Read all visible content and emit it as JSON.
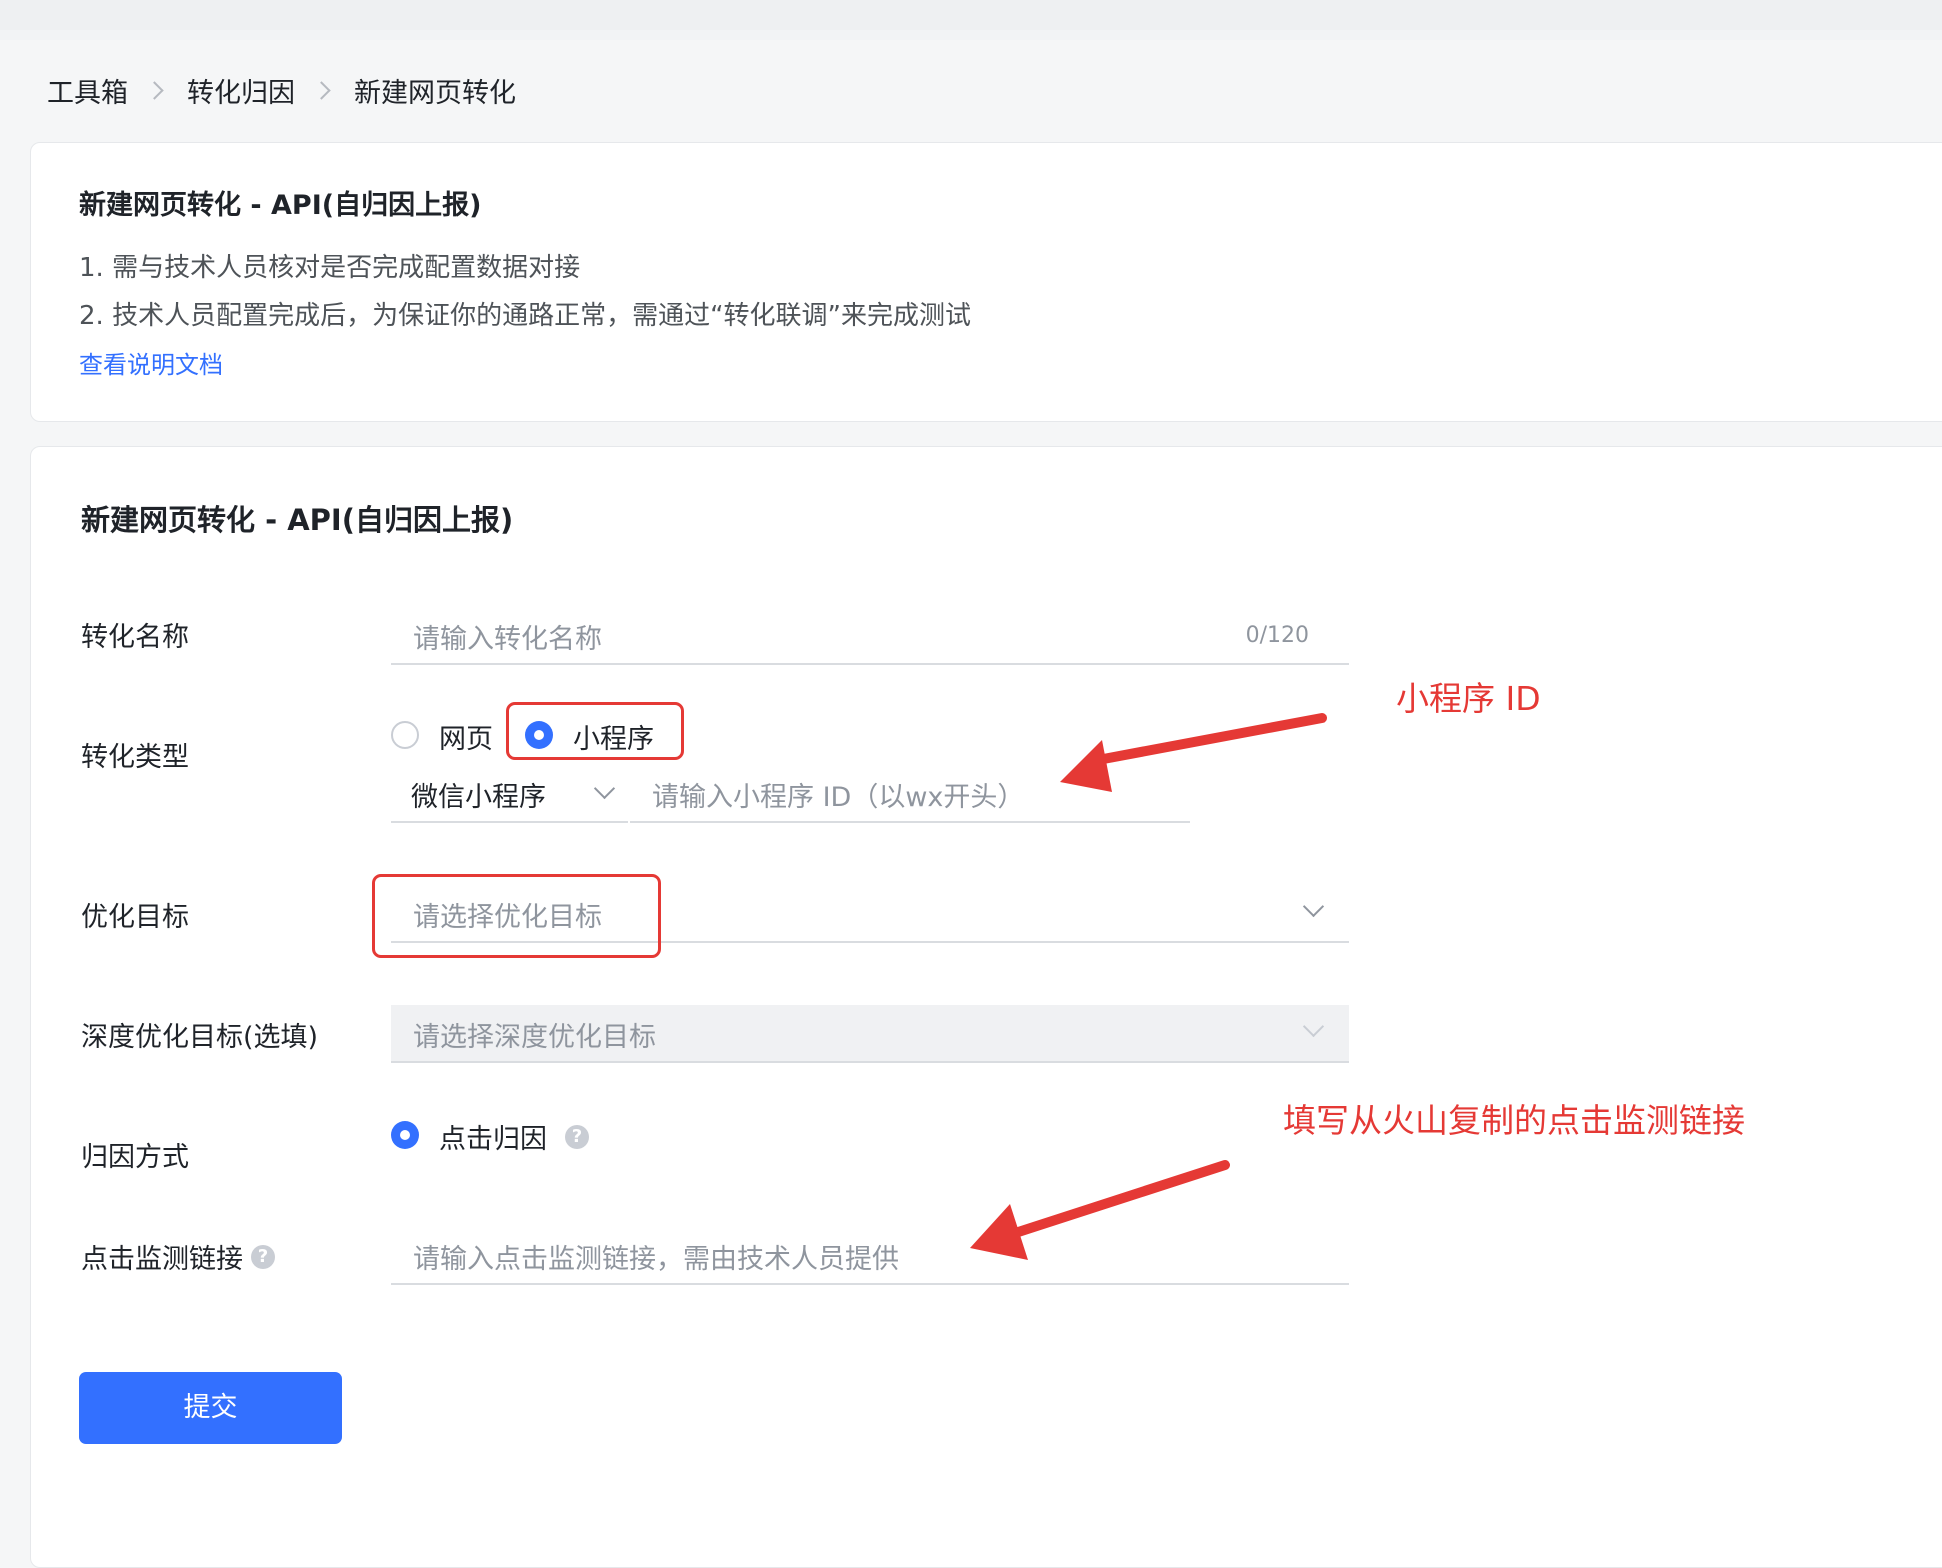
{
  "breadcrumb": [
    "工具箱",
    "转化归因",
    "新建网页转化"
  ],
  "info_card": {
    "title": "新建网页转化 - API(自归因上报)",
    "line1": "1. 需与技术人员核对是否完成配置数据对接",
    "line2": "2. 技术人员配置完成后，为保证你的通路正常，需通过“转化联调”来完成测试",
    "link": "查看说明文档"
  },
  "form": {
    "title": "新建网页转化 - API(自归因上报)",
    "conversion_name": {
      "label": "转化名称",
      "placeholder": "请输入转化名称",
      "counter": "0/120"
    },
    "conversion_type": {
      "label": "转化类型",
      "options": [
        "网页",
        "小程序"
      ],
      "selected": "小程序",
      "mini_program_type": "微信小程序",
      "mini_program_id_placeholder": "请输入小程序 ID（以wx开头）"
    },
    "optimization_goal": {
      "label": "优化目标",
      "placeholder": "请选择优化目标"
    },
    "deep_goal": {
      "label": "深度优化目标(选填)",
      "placeholder": "请选择深度优化目标"
    },
    "attribution": {
      "label": "归因方式",
      "option": "点击归因",
      "selected": true
    },
    "click_link": {
      "label": "点击监测链接",
      "placeholder": "请输入点击监测链接，需由技术人员提供"
    },
    "submit_label": "提交"
  },
  "annotations": {
    "mini_program_id_note": "小程序 ID",
    "click_link_note": "填写从火山复制的点击监测链接",
    "color": "#e53935"
  },
  "colors": {
    "accent": "#3370ff",
    "annotation": "#e53935"
  },
  "icons": [
    "chevron-right-icon",
    "chevron-down-icon",
    "help-icon",
    "radio-icon",
    "arrow-icon"
  ]
}
